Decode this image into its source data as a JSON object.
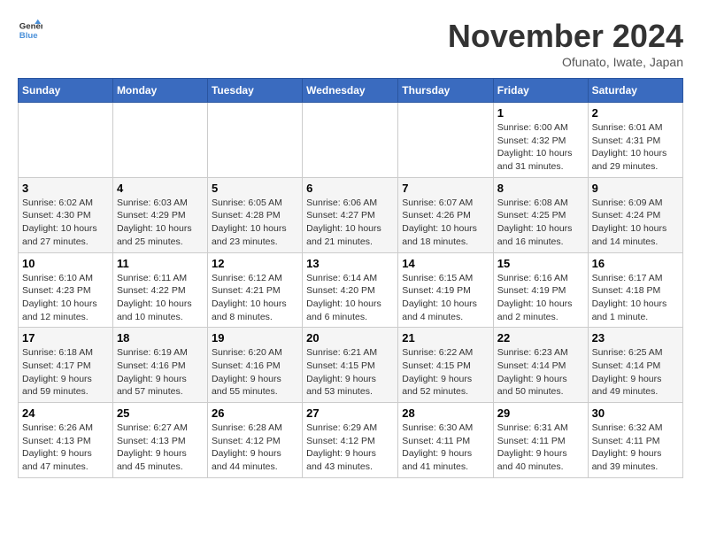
{
  "logo": {
    "line1": "General",
    "line2": "Blue"
  },
  "title": "November 2024",
  "location": "Ofunato, Iwate, Japan",
  "weekdays": [
    "Sunday",
    "Monday",
    "Tuesday",
    "Wednesday",
    "Thursday",
    "Friday",
    "Saturday"
  ],
  "weeks": [
    [
      {
        "day": "",
        "info": ""
      },
      {
        "day": "",
        "info": ""
      },
      {
        "day": "",
        "info": ""
      },
      {
        "day": "",
        "info": ""
      },
      {
        "day": "",
        "info": ""
      },
      {
        "day": "1",
        "info": "Sunrise: 6:00 AM\nSunset: 4:32 PM\nDaylight: 10 hours\nand 31 minutes."
      },
      {
        "day": "2",
        "info": "Sunrise: 6:01 AM\nSunset: 4:31 PM\nDaylight: 10 hours\nand 29 minutes."
      }
    ],
    [
      {
        "day": "3",
        "info": "Sunrise: 6:02 AM\nSunset: 4:30 PM\nDaylight: 10 hours\nand 27 minutes."
      },
      {
        "day": "4",
        "info": "Sunrise: 6:03 AM\nSunset: 4:29 PM\nDaylight: 10 hours\nand 25 minutes."
      },
      {
        "day": "5",
        "info": "Sunrise: 6:05 AM\nSunset: 4:28 PM\nDaylight: 10 hours\nand 23 minutes."
      },
      {
        "day": "6",
        "info": "Sunrise: 6:06 AM\nSunset: 4:27 PM\nDaylight: 10 hours\nand 21 minutes."
      },
      {
        "day": "7",
        "info": "Sunrise: 6:07 AM\nSunset: 4:26 PM\nDaylight: 10 hours\nand 18 minutes."
      },
      {
        "day": "8",
        "info": "Sunrise: 6:08 AM\nSunset: 4:25 PM\nDaylight: 10 hours\nand 16 minutes."
      },
      {
        "day": "9",
        "info": "Sunrise: 6:09 AM\nSunset: 4:24 PM\nDaylight: 10 hours\nand 14 minutes."
      }
    ],
    [
      {
        "day": "10",
        "info": "Sunrise: 6:10 AM\nSunset: 4:23 PM\nDaylight: 10 hours\nand 12 minutes."
      },
      {
        "day": "11",
        "info": "Sunrise: 6:11 AM\nSunset: 4:22 PM\nDaylight: 10 hours\nand 10 minutes."
      },
      {
        "day": "12",
        "info": "Sunrise: 6:12 AM\nSunset: 4:21 PM\nDaylight: 10 hours\nand 8 minutes."
      },
      {
        "day": "13",
        "info": "Sunrise: 6:14 AM\nSunset: 4:20 PM\nDaylight: 10 hours\nand 6 minutes."
      },
      {
        "day": "14",
        "info": "Sunrise: 6:15 AM\nSunset: 4:19 PM\nDaylight: 10 hours\nand 4 minutes."
      },
      {
        "day": "15",
        "info": "Sunrise: 6:16 AM\nSunset: 4:19 PM\nDaylight: 10 hours\nand 2 minutes."
      },
      {
        "day": "16",
        "info": "Sunrise: 6:17 AM\nSunset: 4:18 PM\nDaylight: 10 hours\nand 1 minute."
      }
    ],
    [
      {
        "day": "17",
        "info": "Sunrise: 6:18 AM\nSunset: 4:17 PM\nDaylight: 9 hours\nand 59 minutes."
      },
      {
        "day": "18",
        "info": "Sunrise: 6:19 AM\nSunset: 4:16 PM\nDaylight: 9 hours\nand 57 minutes."
      },
      {
        "day": "19",
        "info": "Sunrise: 6:20 AM\nSunset: 4:16 PM\nDaylight: 9 hours\nand 55 minutes."
      },
      {
        "day": "20",
        "info": "Sunrise: 6:21 AM\nSunset: 4:15 PM\nDaylight: 9 hours\nand 53 minutes."
      },
      {
        "day": "21",
        "info": "Sunrise: 6:22 AM\nSunset: 4:15 PM\nDaylight: 9 hours\nand 52 minutes."
      },
      {
        "day": "22",
        "info": "Sunrise: 6:23 AM\nSunset: 4:14 PM\nDaylight: 9 hours\nand 50 minutes."
      },
      {
        "day": "23",
        "info": "Sunrise: 6:25 AM\nSunset: 4:14 PM\nDaylight: 9 hours\nand 49 minutes."
      }
    ],
    [
      {
        "day": "24",
        "info": "Sunrise: 6:26 AM\nSunset: 4:13 PM\nDaylight: 9 hours\nand 47 minutes."
      },
      {
        "day": "25",
        "info": "Sunrise: 6:27 AM\nSunset: 4:13 PM\nDaylight: 9 hours\nand 45 minutes."
      },
      {
        "day": "26",
        "info": "Sunrise: 6:28 AM\nSunset: 4:12 PM\nDaylight: 9 hours\nand 44 minutes."
      },
      {
        "day": "27",
        "info": "Sunrise: 6:29 AM\nSunset: 4:12 PM\nDaylight: 9 hours\nand 43 minutes."
      },
      {
        "day": "28",
        "info": "Sunrise: 6:30 AM\nSunset: 4:11 PM\nDaylight: 9 hours\nand 41 minutes."
      },
      {
        "day": "29",
        "info": "Sunrise: 6:31 AM\nSunset: 4:11 PM\nDaylight: 9 hours\nand 40 minutes."
      },
      {
        "day": "30",
        "info": "Sunrise: 6:32 AM\nSunset: 4:11 PM\nDaylight: 9 hours\nand 39 minutes."
      }
    ]
  ]
}
